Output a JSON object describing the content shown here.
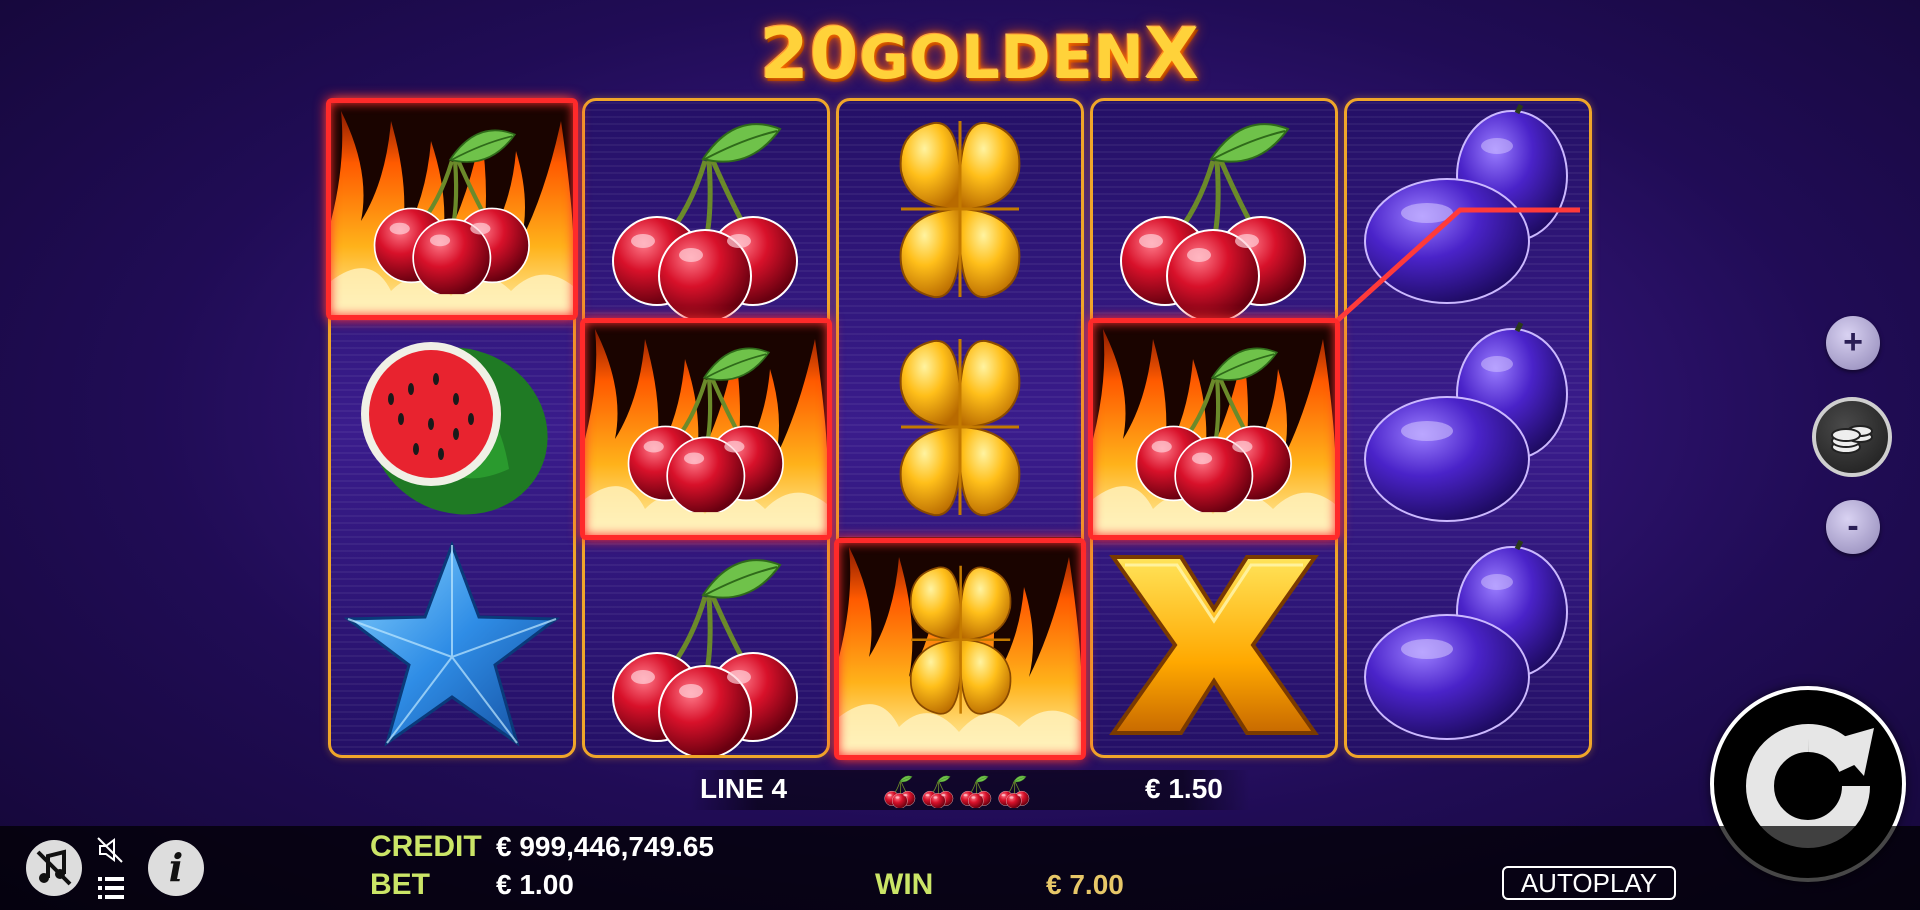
{
  "game": {
    "title_number": "20",
    "title_word": "GOLDEN",
    "title_x": "X"
  },
  "reels": [
    [
      "fire-cherry",
      "watermelon",
      "blue-star"
    ],
    [
      "cherry",
      "fire-cherry",
      "cherry"
    ],
    [
      "golden-clover",
      "golden-clover",
      "fire-golden-clover"
    ],
    [
      "cherry",
      "fire-cherry",
      "golden-x"
    ],
    [
      "plum",
      "plum",
      "plum"
    ]
  ],
  "win_line": {
    "label": "LINE 4",
    "symbol_count": 4,
    "symbol": "cherry-icon",
    "amount": "€ 1.50"
  },
  "status": {
    "credit_label": "CREDIT",
    "credit_value": "€ 999,446,749.65",
    "bet_label": "BET",
    "bet_value": "€ 1.00",
    "win_label": "WIN",
    "win_value": "€ 7.00",
    "autoplay_label": "AUTOPLAY"
  },
  "controls": {
    "bet_plus": "+",
    "bet_minus": "-",
    "info": "i"
  },
  "colors": {
    "win_frame": "#ff2a2a",
    "reel_border": "#f0a62a",
    "label_green": "#cbe567",
    "win_gold": "#e7c768"
  }
}
